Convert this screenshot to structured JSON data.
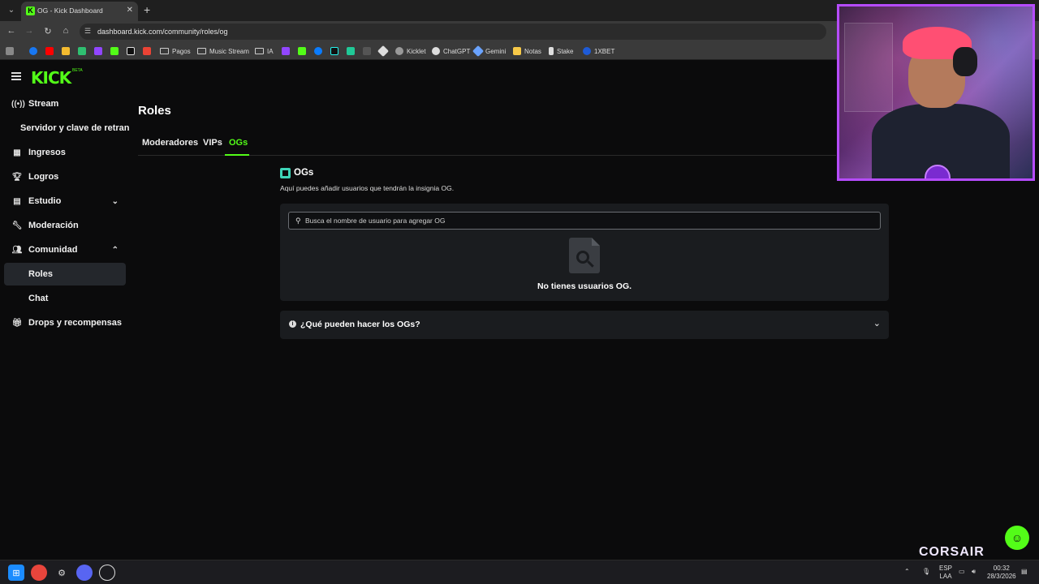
{
  "browser": {
    "tab_title": "OG - Kick Dashboard",
    "url": "dashboard.kick.com/community/roles/og",
    "bookmarks": [
      "Pagos",
      "Music Stream",
      "IA",
      "Kicklet",
      "ChatGPT",
      "Gemini",
      "Notas",
      "Stake",
      "1XBET"
    ]
  },
  "brand": {
    "logo": "KICK",
    "beta": "BETA",
    "accent": "#53fc18"
  },
  "sidebar": {
    "items": [
      {
        "label": "Stream",
        "icon": "broadcast-icon"
      },
      {
        "label": "Servidor y clave de retransmisión"
      },
      {
        "label": "Ingresos",
        "icon": "chart-icon"
      },
      {
        "label": "Logros",
        "icon": "trophy-icon"
      },
      {
        "label": "Estudio",
        "icon": "grid-icon"
      },
      {
        "label": "Moderación",
        "icon": "wrench-icon"
      },
      {
        "label": "Comunidad",
        "icon": "users-icon"
      },
      {
        "label": "Roles"
      },
      {
        "label": "Chat"
      },
      {
        "label": "Drops y recompensas",
        "icon": "gift-icon"
      }
    ]
  },
  "main": {
    "title": "Roles",
    "tabs": [
      "Moderadores",
      "VIPs",
      "OGs"
    ],
    "active_tab": "OGs",
    "section_title": "OGs",
    "section_desc": "Aquí puedes añadir usuarios que tendrán la insignia OG.",
    "search_placeholder": "Busca el nombre de usuario para agregar OG",
    "empty_text": "No tienes usuarios OG.",
    "faq_label": "¿Qué pueden hacer los OGs?"
  },
  "overlay": {
    "brand": "CORSAIR"
  },
  "taskbar": {
    "lang1": "ESP",
    "lang2": "LAA",
    "time": "00:32",
    "date": "28/3/2026"
  }
}
